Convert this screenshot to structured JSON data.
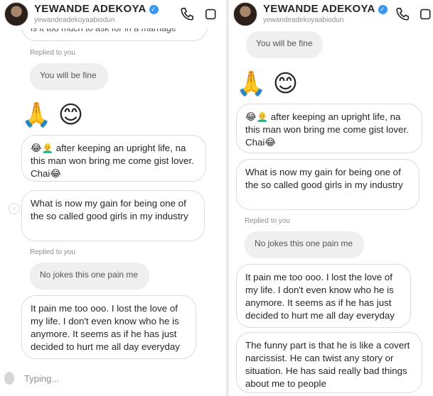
{
  "header": {
    "name": "YEWANDE ADEKOYA",
    "verified_mark": "✓",
    "handle": "yewandeadekoyaabiodun",
    "icons": [
      "phone-icon",
      "video-icon"
    ]
  },
  "left": {
    "top_cut_text": "is it too much to ask for in a marriage",
    "replied_1": "Replied to you",
    "reply_quote_1": "You will be fine",
    "emojis": "🙏 😊",
    "msg_1": "😂👨‍🦲 after keeping an upright life, na this man won bring me come gist lover. Chai😂",
    "msg_2": "What is now my gain for being one of the so called good girls in my industry",
    "replied_2": "Replied to you",
    "reply_quote_2": "No jokes this one pain me",
    "msg_3": "It pain me too ooo. I lost the love of my life. I don't even know who he is anymore. It seems as if he has just decided to hurt me all day everyday",
    "typing": "Typing..."
  },
  "right": {
    "reply_quote_top": "You will be fine",
    "emojis": "🙏 😊",
    "msg_1": "😂👨‍🦲 after keeping an upright life, na this man won bring me come gist lover. Chai😂",
    "msg_2": "What is now my gain for being one of the so called good girls in my industry",
    "replied": "Replied to you",
    "reply_quote": "No jokes this one pain me",
    "msg_3": "It pain me too ooo. I lost the love of my life. I don't even know who he is anymore. It seems as if he has just decided to hurt me all day everyday",
    "msg_4": "The funny part is that he is like a covert narcissist. He can twist any story or situation. He has said really bad things about me to people"
  }
}
